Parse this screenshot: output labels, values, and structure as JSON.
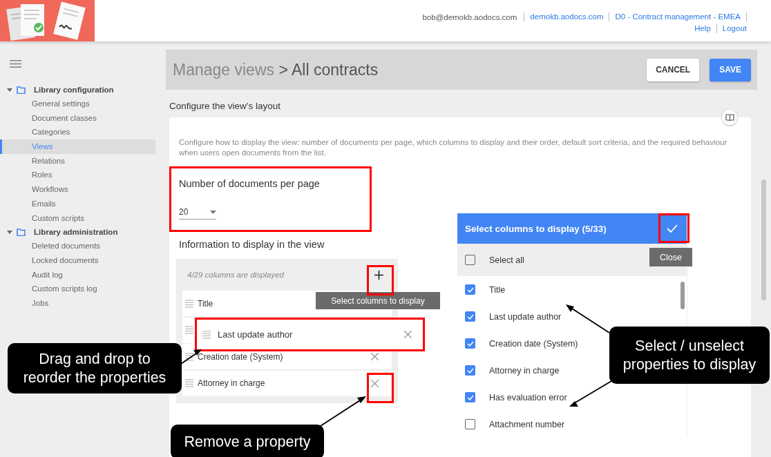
{
  "header": {
    "user_email": "bob@demokb.aodocs.com",
    "link_rows": [
      [
        "demokb.aodocs.com",
        "D0 - Contract management - EMEA"
      ],
      [
        "Help",
        "Logout"
      ]
    ]
  },
  "sidebar": {
    "sections": [
      {
        "label": "Library configuration",
        "expanded": true,
        "children": [
          {
            "label": "General settings",
            "selected": false
          },
          {
            "label": "Document classes",
            "selected": false
          },
          {
            "label": "Categories",
            "selected": false
          },
          {
            "label": "Views",
            "selected": true
          },
          {
            "label": "Relations",
            "selected": false
          },
          {
            "label": "Roles",
            "selected": false
          },
          {
            "label": "Workflows",
            "selected": false
          },
          {
            "label": "Emails",
            "selected": false
          },
          {
            "label": "Custom scripts",
            "selected": false
          }
        ]
      },
      {
        "label": "Library administration",
        "expanded": true,
        "children": [
          {
            "label": "Deleted documents",
            "selected": false
          },
          {
            "label": "Locked documents",
            "selected": false
          },
          {
            "label": "Audit log",
            "selected": false
          },
          {
            "label": "Custom scripts log",
            "selected": false
          },
          {
            "label": "Jobs",
            "selected": false
          }
        ]
      }
    ]
  },
  "page_header": {
    "breadcrumb": "Manage views",
    "title": "> All contracts",
    "buttons": [
      {
        "label": "CANCEL",
        "kind": "secondary"
      },
      {
        "label": "SAVE",
        "kind": "primary"
      }
    ]
  },
  "section_title": "Configure the view's layout",
  "card": {
    "description": "Configure how to display the view: number of documents per page, which columns to display and their order, default sort criteria, and the required behaviour when users open documents from the list.",
    "documents_per_page": {
      "label": "Number of documents per page",
      "value": "20"
    },
    "columns_panel": {
      "heading": "Information to display in the view",
      "count_text": "4/29 columns are displayed",
      "add_tooltip": "Select columns to display",
      "rows": [
        {
          "kind": "item",
          "label": "Title"
        },
        {
          "kind": "placeholder"
        },
        {
          "kind": "item",
          "label": "Creation date (System)"
        },
        {
          "kind": "item",
          "label": "Attorney in charge"
        }
      ],
      "dragged_row": {
        "label": "Last update author"
      }
    },
    "column_picker": {
      "title": "Select columns to display (5/33)",
      "close_tooltip": "Close",
      "select_all": {
        "label": "Select all",
        "checked": false
      },
      "options": [
        {
          "label": "Title",
          "checked": true
        },
        {
          "label": "Last update author",
          "checked": true
        },
        {
          "label": "Creation date (System)",
          "checked": true
        },
        {
          "label": "Attorney in charge",
          "checked": true
        },
        {
          "label": "Has evaluation error",
          "checked": true
        },
        {
          "label": "Attachment number",
          "checked": false
        }
      ]
    }
  },
  "annotations": [
    {
      "text": "Drag and drop to\nreorder the properties"
    },
    {
      "text": "Remove a property"
    },
    {
      "text": "Select / unselect\nproperties to display"
    }
  ]
}
